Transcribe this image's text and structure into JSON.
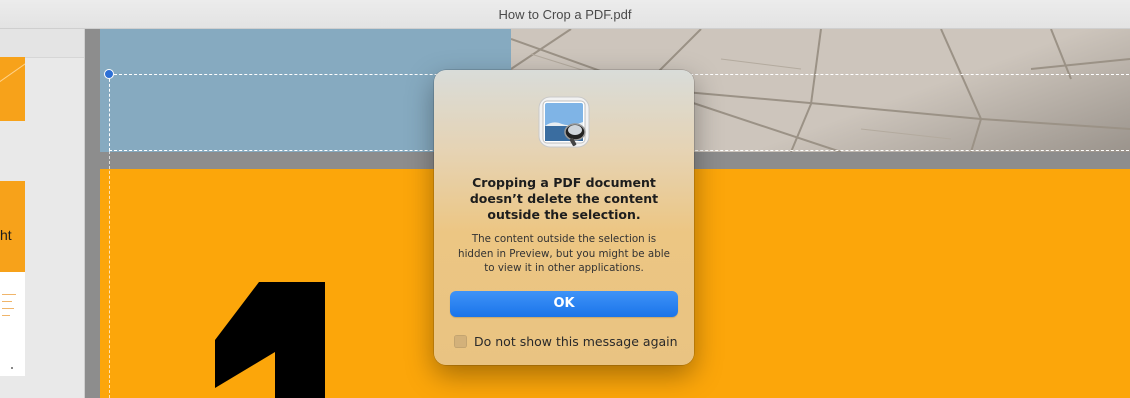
{
  "window": {
    "title": "How to Crop a PDF.pdf"
  },
  "sidebar": {
    "thumbnail_text": "ht"
  },
  "dialog": {
    "app_icon": "preview-app-icon",
    "heading_lines": [
      "Cropping a PDF document",
      "doesn’t delete the content",
      "outside the selection."
    ],
    "body_lines": [
      "The content outside the selection is",
      "hidden in Preview, but you might be able",
      "to view it in other applications."
    ],
    "ok_label": "OK",
    "checkbox_label": "Do not show this message again",
    "checkbox_checked": false
  },
  "colors": {
    "accent_button": "#1a74ea",
    "page_orange": "#fca60a",
    "page_blue": "#86aac0",
    "selection_handle": "#2c6fd6"
  }
}
